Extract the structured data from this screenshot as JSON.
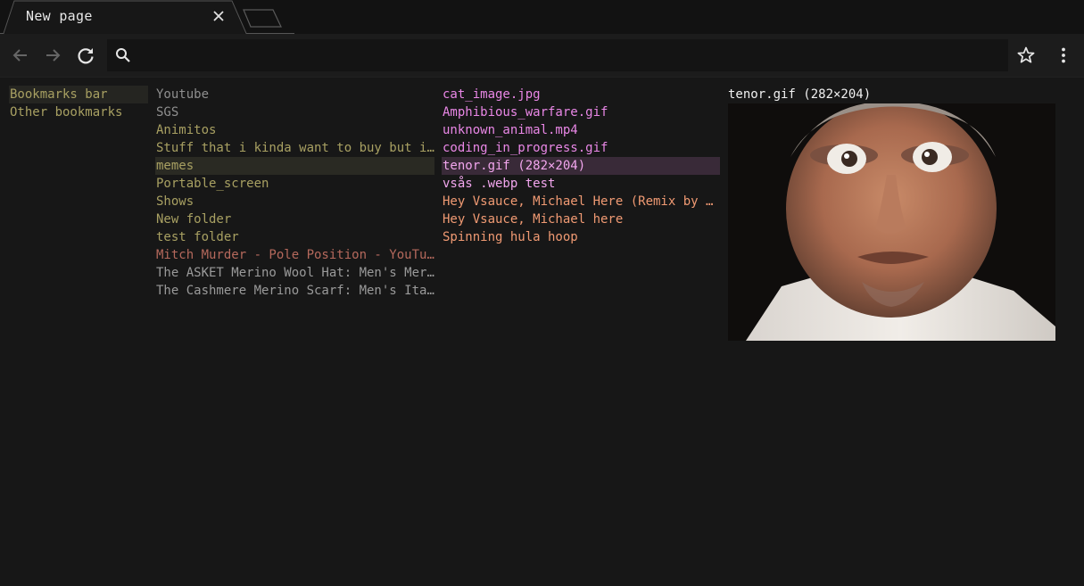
{
  "tab": {
    "title": "New page"
  },
  "omnibox": {
    "value": "",
    "placeholder": ""
  },
  "icons": {
    "back": "arrow-left-icon",
    "forward": "arrow-right-icon",
    "reload": "reload-icon",
    "search": "search-icon",
    "bookmark": "star-icon",
    "menu": "kebab-menu-icon",
    "close": "close-icon"
  },
  "columns": {
    "roots": [
      {
        "label": "Bookmarks bar",
        "selected": true
      },
      {
        "label": "Other bookmarks"
      }
    ],
    "bar_items": [
      {
        "label": "Youtube",
        "kind": "folder-dim"
      },
      {
        "label": "SGS",
        "kind": "folder-dim"
      },
      {
        "label": "Animitos",
        "kind": "folder"
      },
      {
        "label": "Stuff that i kinda want to buy but idk",
        "kind": "folder"
      },
      {
        "label": "memes",
        "kind": "folder",
        "selected": true
      },
      {
        "label": "Portable_screen",
        "kind": "folder"
      },
      {
        "label": "Shows",
        "kind": "folder"
      },
      {
        "label": "New folder",
        "kind": "folder"
      },
      {
        "label": "test folder",
        "kind": "folder"
      },
      {
        "label": "Mitch Murder - Pole Position - YouTube",
        "kind": "link-red"
      },
      {
        "label": "The ASKET Merino Wool Hat: Men's Merino Wool Hat",
        "kind": "link-gray"
      },
      {
        "label": "The Cashmere Merino Scarf: Men's Italian Scarf",
        "kind": "link-gray"
      }
    ],
    "memes_items": [
      {
        "label": "cat_image.jpg",
        "kind": "file"
      },
      {
        "label": "Amphibious_warfare.gif",
        "kind": "file"
      },
      {
        "label": "unknown_animal.mp4",
        "kind": "file"
      },
      {
        "label": "coding_in_progress.gif",
        "kind": "file"
      },
      {
        "label": "tenor.gif (282×204)",
        "kind": "file-sel",
        "selected": true
      },
      {
        "label": "vsås .webp test",
        "kind": "file-sel"
      },
      {
        "label": "Hey Vsauce, Michael Here (Remix by Mr. Vsauce)",
        "kind": "link-orange"
      },
      {
        "label": "Hey Vsauce, Michael here",
        "kind": "link-orange"
      },
      {
        "label": "Spinning hula hoop",
        "kind": "link-orange"
      }
    ]
  },
  "preview": {
    "title": "tenor.gif (282×204)"
  },
  "colors": {
    "background": "#171717",
    "folder": "#a8a062",
    "file": "#e987e6",
    "link": "#f09a73",
    "selection": "#392a38"
  }
}
